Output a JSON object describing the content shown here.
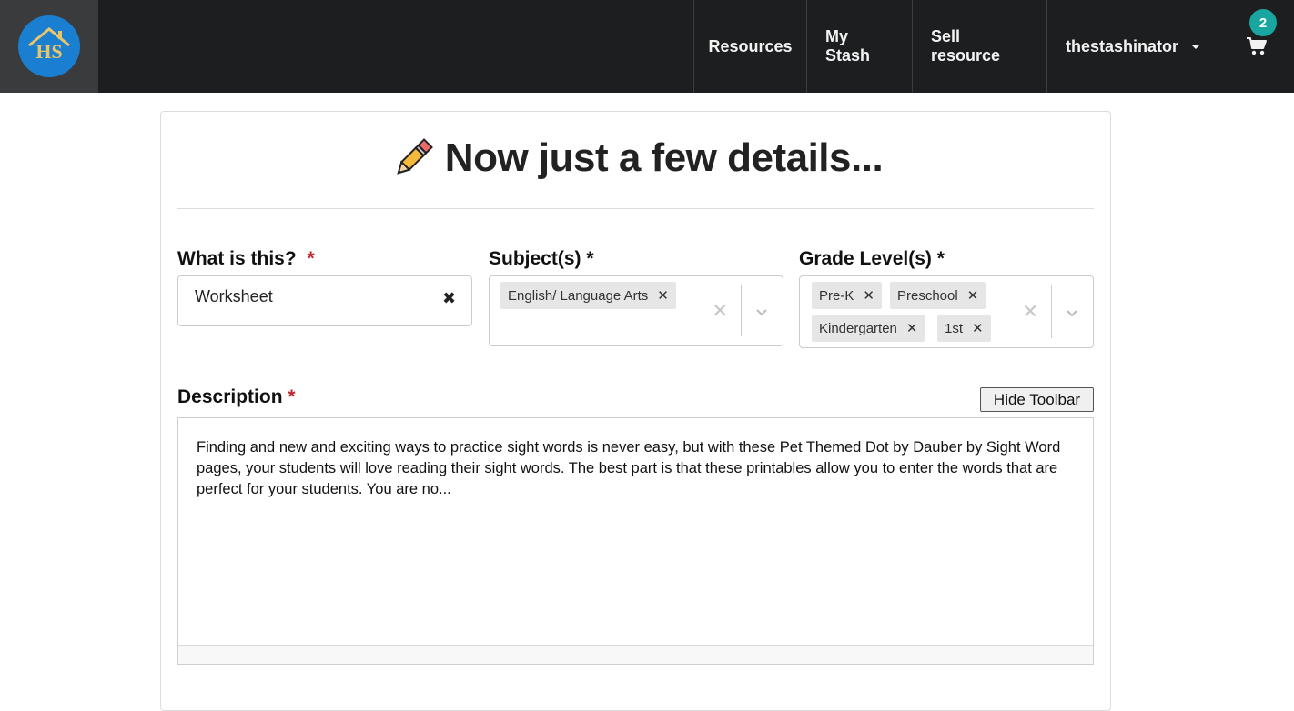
{
  "navbar": {
    "logo_text": "HS",
    "items": [
      {
        "label": "Resources"
      },
      {
        "label": "My Stash"
      },
      {
        "label": "Sell resource"
      }
    ],
    "user": {
      "name": "thestashinator"
    },
    "cart": {
      "count": "2"
    }
  },
  "form": {
    "heading": "Now just a few details...",
    "type_field": {
      "label": "What is this?",
      "required_mark": "*",
      "value": "Worksheet",
      "clear_glyph": "✖"
    },
    "subjects_field": {
      "label": "Subject(s)",
      "required_mark": "*",
      "chips": [
        "English/ Language Arts"
      ]
    },
    "grades_field": {
      "label": "Grade Level(s)",
      "required_mark": "*",
      "chips": [
        "Pre-K",
        "Preschool",
        "Kindergarten",
        "1st"
      ]
    },
    "chip_remove_glyph": "✕",
    "clear_all_glyph": "✕",
    "description": {
      "label": "Description",
      "required_mark": "*",
      "toolbar_button": "Hide Toolbar",
      "text": "Finding and new and exciting ways to practice sight words is never easy, but with these Pet Themed Dot by Dauber by Sight Word pages, your students will love reading their sight words. The best part is that these printables allow you to enter the words that are perfect for your students. You are no..."
    }
  },
  "colors": {
    "navbar_bg": "#1d1e1f",
    "logo_bg": "#1a7fd0",
    "badge_bg": "#1aa6a0",
    "required_red": "#c0282d",
    "chip_bg": "#e6e6e6"
  }
}
